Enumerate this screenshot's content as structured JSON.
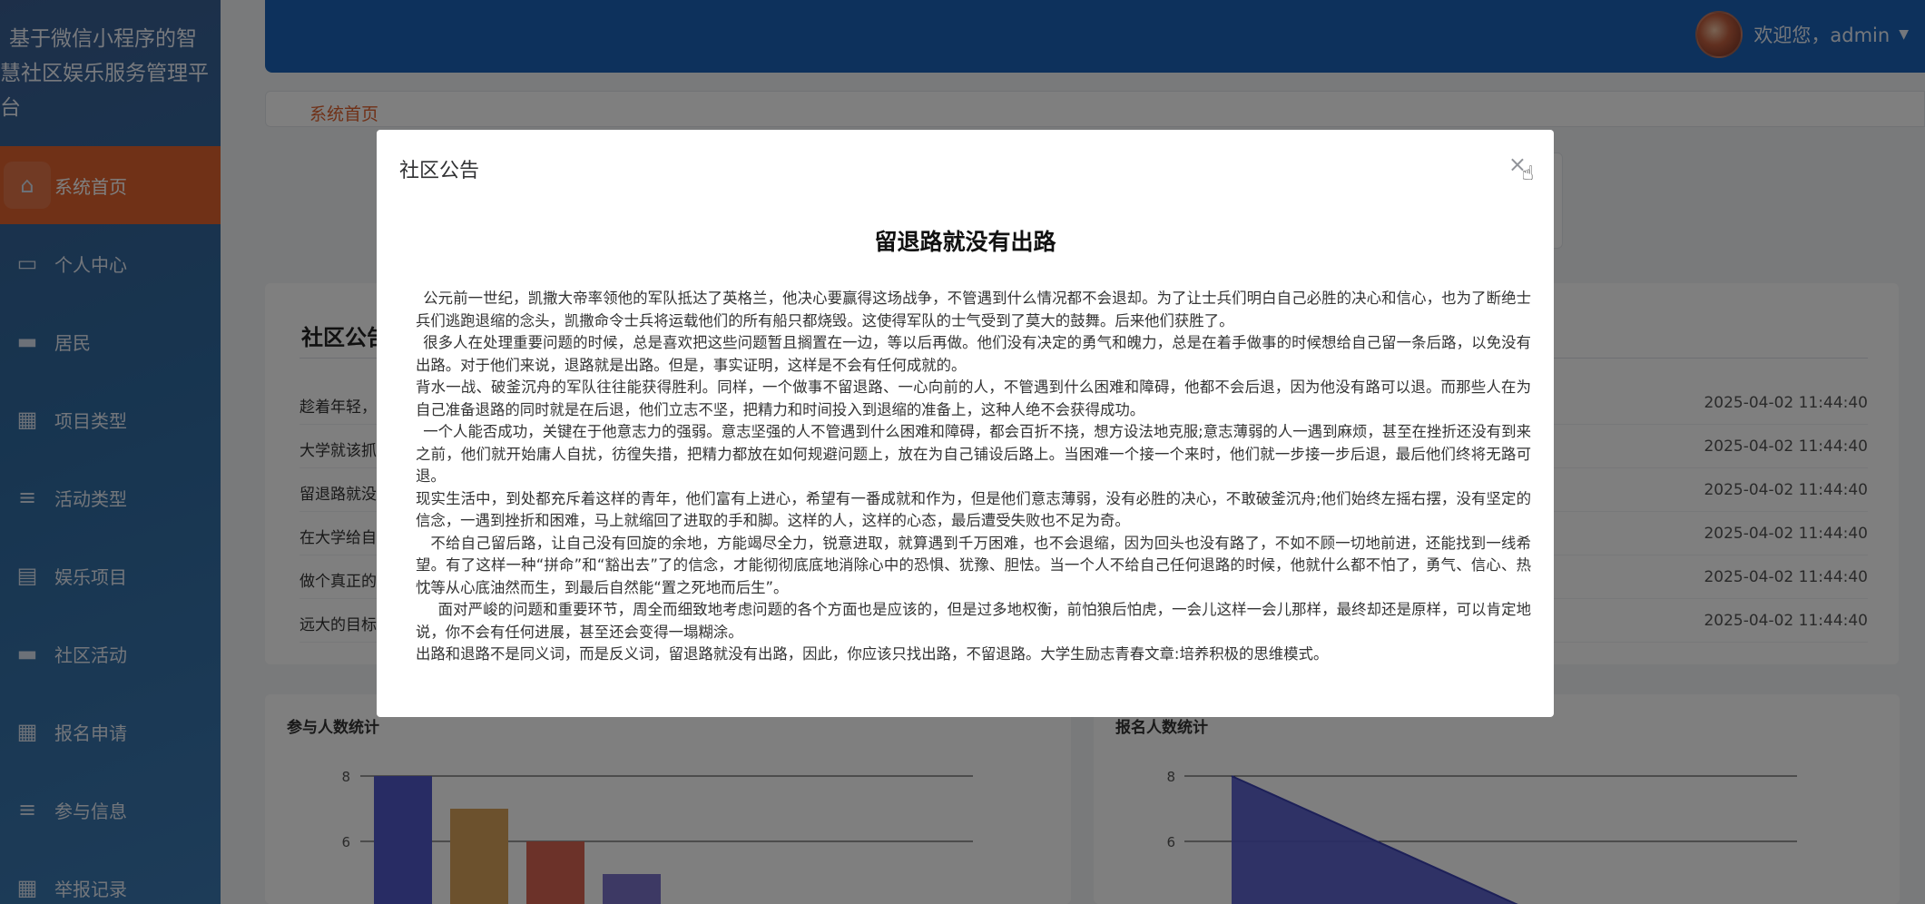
{
  "sidebar": {
    "brand_lines": [
      "基于微信小程序的智",
      "慧社区娱乐服务管理平",
      "台"
    ],
    "items": [
      {
        "label": "系统首页",
        "icon": "home-icon"
      },
      {
        "label": "个人中心",
        "icon": "id-card-icon"
      },
      {
        "label": "居民",
        "icon": "monitor-icon"
      },
      {
        "label": "项目类型",
        "icon": "grid-icon"
      },
      {
        "label": "活动类型",
        "icon": "list-icon"
      },
      {
        "label": "娱乐项目",
        "icon": "clipboard-icon"
      },
      {
        "label": "社区活动",
        "icon": "monitor-icon"
      },
      {
        "label": "报名申请",
        "icon": "grid-icon"
      },
      {
        "label": "参与信息",
        "icon": "list-icon"
      },
      {
        "label": "举报记录",
        "icon": "grid-icon"
      }
    ],
    "active_color": "#e0622f"
  },
  "header": {
    "welcome": "欢迎您，admin",
    "color": "#1a63b8"
  },
  "tabs": {
    "home": "系统首页"
  },
  "notices": {
    "title": "社区公告",
    "rows": [
      {
        "title": "趁着年轻，",
        "date": "2025-04-02 11:44:40"
      },
      {
        "title": "大学就该抓",
        "date": "2025-04-02 11:44:40"
      },
      {
        "title": "留退路就没",
        "date": "2025-04-02 11:44:40"
      },
      {
        "title": "在大学给自",
        "date": "2025-04-02 11:44:40"
      },
      {
        "title": "做个真正的",
        "date": "2025-04-02 11:44:40"
      },
      {
        "title": "远大的目标",
        "date": "2025-04-02 11:44:40"
      }
    ]
  },
  "charts": {
    "participants_title": "参与人数统计",
    "signups_title": "报名人数统计"
  },
  "chart_data": [
    {
      "type": "bar",
      "title": "参与人数统计",
      "categories": [
        "",
        "",
        "",
        ""
      ],
      "values": [
        8,
        7,
        6,
        5
      ],
      "colors": [
        "#5058c8",
        "#d9a35b",
        "#d86453",
        "#7b73c9"
      ],
      "yticks": [
        6,
        8
      ]
    },
    {
      "type": "area",
      "title": "报名人数统计",
      "values": [
        8,
        4
      ],
      "color": "#5058c8",
      "yticks": [
        6,
        8
      ]
    }
  ],
  "modal": {
    "title": "社区公告",
    "close": "×",
    "article_title": "留退路就没有出路",
    "paragraphs": [
      "公元前一世纪，凯撒大帝率领他的军队抵达了英格兰，他决心要赢得这场战争，不管遇到什么情况都不会退却。为了让士兵们明白自己必胜的决心和信心，也为了断绝士兵们逃跑退缩的念头，凯撒命令士兵将运载他们的所有船只都烧毁。这使得军队的士气受到了莫大的鼓舞。后来他们获胜了。",
      "很多人在处理重要问题的时候，总是喜欢把这些问题暂且搁置在一边，等以后再做。他们没有决定的勇气和魄力，总是在着手做事的时候想给自己留一条后路，以免没有出路。对于他们来说，退路就是出路。但是，事实证明，这样是不会有任何成就的。",
      "背水一战、破釜沉舟的军队往往能获得胜利。同样，一个做事不留退路、一心向前的人，不管遇到什么困难和障碍，他都不会后退，因为他没有路可以退。而那些人在为自己准备退路的同时就是在后退，他们立志不坚，把精力和时间投入到退缩的准备上，这种人绝不会获得成功。",
      "一个人能否成功，关键在于他意志力的强弱。意志坚强的人不管遇到什么困难和障碍，都会百折不挠，想方设法地克服;意志薄弱的人一遇到麻烦，甚至在挫折还没有到来之前，他们就开始庸人自扰，彷徨失措，把精力都放在如何规避问题上，放在为自己铺设后路上。当困难一个接一个来时，他们就一步接一步后退，最后他们终将无路可退。",
      "现实生活中，到处都充斥着这样的青年，他们富有上进心，希望有一番成就和作为，但是他们意志薄弱，没有必胜的决心，不敢破釜沉舟;他们始终左摇右摆，没有坚定的信念，一遇到挫折和困难，马上就缩回了进取的手和脚。这样的人，这样的心态，最后遭受失败也不足为奇。",
      "不给自己留后路，让自己没有回旋的余地，方能竭尽全力，锐意进取，就算遇到千万困难，也不会退缩，因为回头也没有路了，不如不顾一切地前进，还能找到一线希望。有了这样一种“拼命”和“豁出去”了的信念，才能彻彻底底地消除心中的恐惧、犹豫、胆怯。当一个人不给自己任何退路的时候，他就什么都不怕了，勇气、信心、热忱等从心底油然而生，到最后自然能“置之死地而后生”。",
      "面对严峻的问题和重要环节，周全而细致地考虑问题的各个方面也是应该的，但是过多地权衡，前怕狼后怕虎，一会儿这样一会儿那样，最终却还是原样，可以肯定地说，你不会有任何进展，甚至还会变得一塌糊涂。",
      "出路和退路不是同义词，而是反义词，留退路就没有出路，因此，你应该只找出路，不留退路。大学生励志青春文章:培养积极的思维模式。"
    ],
    "indents": [
      1,
      1,
      0,
      1,
      0,
      2,
      3,
      0
    ]
  }
}
